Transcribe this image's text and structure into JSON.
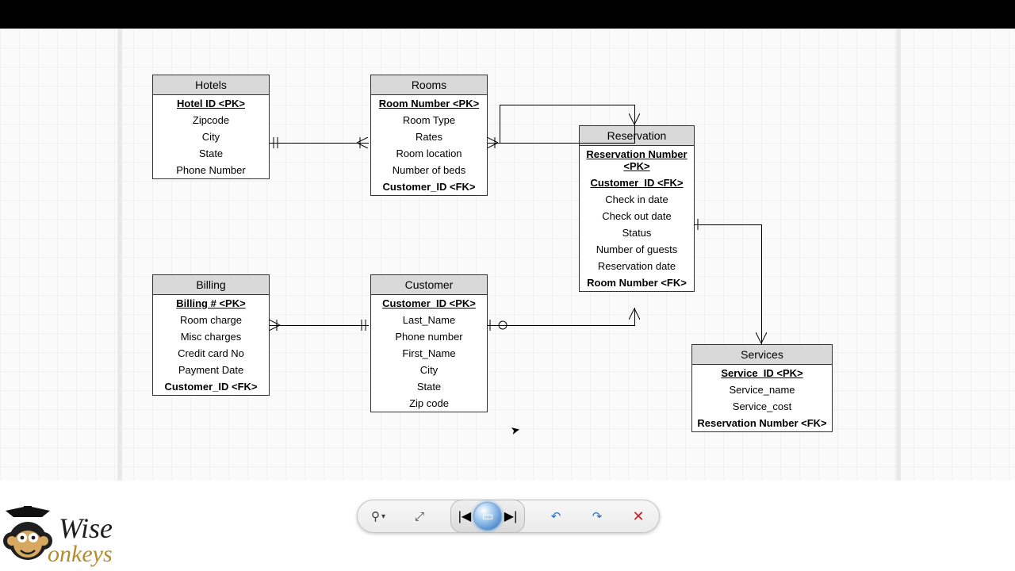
{
  "logo": {
    "line1": "Wise",
    "line2": "onkeys"
  },
  "entities": {
    "hotels": {
      "title": "Hotels",
      "rows": {
        "pk": "Hotel ID <PK>",
        "zipcode": "Zipcode",
        "city": "City",
        "state": "State",
        "phone": "Phone Number"
      }
    },
    "rooms": {
      "title": "Rooms",
      "rows": {
        "pk": "Room Number <PK>",
        "type": "Room Type",
        "rates": "Rates",
        "loc": "Room location",
        "beds": "Number of beds",
        "fk": "Customer_ID <FK>"
      }
    },
    "reservation": {
      "title": "Reservation",
      "rows": {
        "pk1": "Reservation Number",
        "pk2": "<PK>",
        "cust": "Customer_ID <FK>",
        "checkin": "Check in date",
        "checkout": "Check out date",
        "status": "Status",
        "guests": "Number of guests",
        "resdate": "Reservation date",
        "roomfk": "Room Number <FK>"
      }
    },
    "billing": {
      "title": "Billing",
      "rows": {
        "pk": "Billing # <PK>",
        "room": "Room charge",
        "misc": "Misc charges",
        "cc": "Credit card No",
        "paydate": "Payment Date",
        "fk": "Customer_ID <FK>"
      }
    },
    "customer": {
      "title": "Customer",
      "rows": {
        "pk": "Customer_ID <PK>",
        "last": "Last_Name",
        "phone": "Phone number",
        "first": "First_Name",
        "city": "City",
        "state": "State",
        "zip": "Zip code"
      }
    },
    "services": {
      "title": "Services",
      "rows": {
        "pk": "Service_ID <PK>",
        "name": "Service_name",
        "cost": "Service_cost",
        "fk": "Reservation Number <FK>"
      }
    }
  },
  "toolbar": {
    "zoom": "⚲",
    "zoomdrop": "▾",
    "fit": "⤢",
    "first": "|◀",
    "play": "▭",
    "last": "▶|",
    "undo": "↶",
    "redo": "↷",
    "close": "✕"
  }
}
